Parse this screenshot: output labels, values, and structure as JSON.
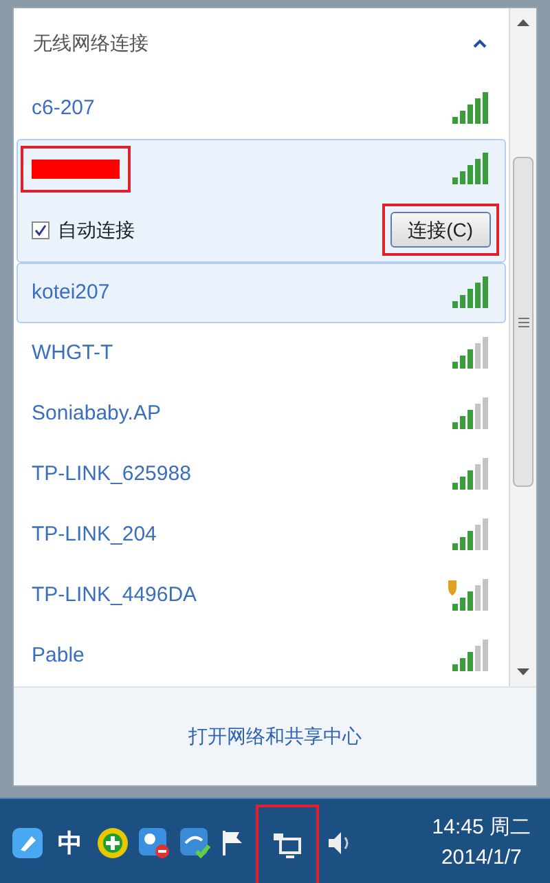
{
  "section": {
    "title": "无线网络连接",
    "expanded": true
  },
  "networks": [
    {
      "name": "c6-207",
      "kind": "full",
      "highlighted": false
    },
    {
      "redacted": true,
      "kind": "full",
      "highlighted": true,
      "annotated": true,
      "auto_connect": {
        "label": "自动连接",
        "checked": true
      },
      "connect_button": {
        "label": "连接(C)",
        "annotated": true
      }
    },
    {
      "name": "kotei207",
      "kind": "full",
      "highlighted": true
    },
    {
      "name": "WHGT-T",
      "kind": "partial",
      "highlighted": false
    },
    {
      "name": "Soniababy.AP",
      "kind": "partial",
      "highlighted": false
    },
    {
      "name": "TP-LINK_625988",
      "kind": "partial",
      "highlighted": false
    },
    {
      "name": "TP-LINK_204",
      "kind": "partial",
      "highlighted": false
    },
    {
      "name": "TP-LINK_4496DA",
      "kind": "secured",
      "highlighted": false
    },
    {
      "name": "Pable",
      "kind": "partial",
      "highlighted": false
    }
  ],
  "footer_link": "打开网络和共享中心",
  "taskbar": {
    "icons": [
      {
        "kind": "pen"
      },
      {
        "kind": "ime",
        "label": "中"
      },
      {
        "kind": "plus"
      },
      {
        "kind": "chat"
      },
      {
        "kind": "sync"
      },
      {
        "kind": "flag"
      },
      {
        "kind": "network",
        "annotated": true
      },
      {
        "kind": "volume"
      }
    ],
    "clock": {
      "time": "14:45 周二",
      "date": "2014/1/7"
    }
  }
}
